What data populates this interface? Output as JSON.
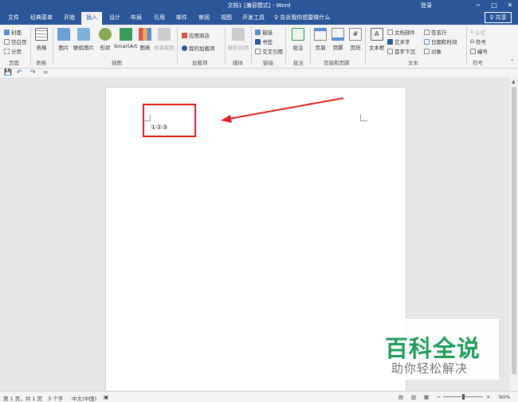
{
  "window": {
    "title": "文档1 [兼容模式] - Word",
    "login": "登录",
    "controls": [
      "─",
      "□",
      "✕"
    ]
  },
  "tabs": [
    "文件",
    "经典菜单",
    "开始",
    "插入",
    "设计",
    "布局",
    "引用",
    "邮件",
    "审阅",
    "视图",
    "开发工具"
  ],
  "tell_me": "♀ 告诉我你想要做什么",
  "share": "♀ 共享",
  "ribbon": {
    "pages": {
      "items": [
        "封面",
        "空白页",
        "分页"
      ],
      "label": "页面"
    },
    "tables": {
      "button": "表格",
      "label": "表格"
    },
    "illustrations": {
      "buttons": [
        "图片",
        "联机图片",
        "形状",
        "SmartArt",
        "图表",
        "屏幕截图"
      ],
      "label": "插图"
    },
    "addins": {
      "items": [
        "应用商店",
        "我的加载项"
      ],
      "label": "加载项"
    },
    "media": {
      "button": "联机视频",
      "label": "媒体"
    },
    "links": {
      "items": [
        "链接",
        "书签",
        "交叉引用"
      ],
      "label": "链接"
    },
    "comments": {
      "button": "批注",
      "label": "批注"
    },
    "header_footer": {
      "buttons": [
        "页眉",
        "页脚",
        "页码"
      ],
      "label": "页眉和页脚"
    },
    "text": {
      "big": "文本框",
      "col1": [
        "文档部件",
        "艺术字",
        "首字下沉"
      ],
      "col2": [
        "签名行",
        "日期和时间",
        "对象"
      ],
      "label": "文本"
    },
    "symbols": {
      "items": [
        "公式",
        "符号",
        "编号"
      ],
      "label": "符号"
    }
  },
  "qat": [
    "💾",
    "↶",
    "↷",
    "="
  ],
  "document": {
    "text": "①②③"
  },
  "status": {
    "page": "第 1 页，共 1 页",
    "words": "3 个字",
    "language": "中文(中国)",
    "zoom": "90%"
  },
  "watermark": {
    "big": "百科全说",
    "small": "助你轻松解决"
  },
  "colors": {
    "accent": "#2b579a",
    "annotation": "#e02020",
    "watermark": "#1f9e5a"
  }
}
